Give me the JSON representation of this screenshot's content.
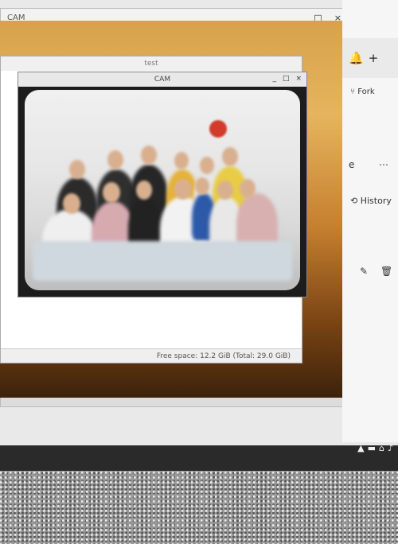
{
  "main_window": {
    "title": "CAM",
    "title_left": "CAM",
    "controls": [
      "_",
      "□",
      "×"
    ]
  },
  "file_manager": {
    "title": "test",
    "status": "Free space: 12.2 GiB (Total: 29.0 GiB)"
  },
  "cam_window": {
    "title": "CAM",
    "controls": [
      "_",
      "□",
      "×"
    ]
  },
  "right_pane": {
    "notification_icon": "bell-icon",
    "add_icon": "plus-icon",
    "fork_label": "Fork",
    "history_label": "History",
    "edit_icon": "pencil-icon",
    "delete_icon": "trash-icon",
    "more_icon": "ellipsis-icon",
    "partial_e": "e"
  },
  "taskbar": {
    "tray_icons": [
      "arrow-up-icon",
      "folder-icon",
      "network-icon",
      "volume-icon"
    ]
  }
}
